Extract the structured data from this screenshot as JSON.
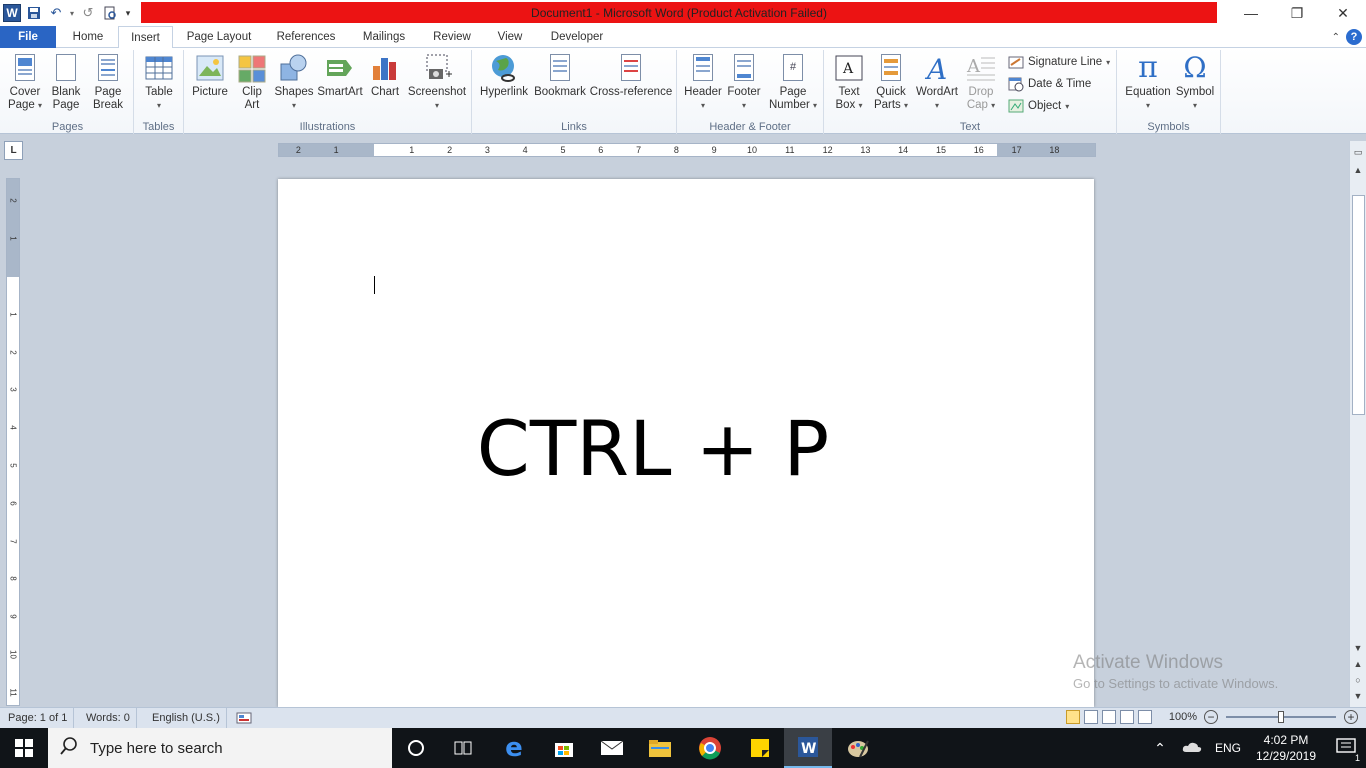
{
  "window": {
    "title": "Document1  -  Microsoft Word (Product Activation Failed)"
  },
  "tabs": [
    "File",
    "Home",
    "Insert",
    "Page Layout",
    "References",
    "Mailings",
    "Review",
    "View",
    "Developer"
  ],
  "active_tab": "Insert",
  "ribbon": {
    "pages": {
      "label": "Pages",
      "cover_page": [
        "Cover",
        "Page"
      ],
      "blank_page": [
        "Blank",
        "Page"
      ],
      "page_break": [
        "Page",
        "Break"
      ]
    },
    "tables": {
      "label": "Tables",
      "table": "Table"
    },
    "illustrations": {
      "label": "Illustrations",
      "picture": "Picture",
      "clip_art": [
        "Clip",
        "Art"
      ],
      "shapes": "Shapes",
      "smartart": "SmartArt",
      "chart": "Chart",
      "screenshot": "Screenshot"
    },
    "links": {
      "label": "Links",
      "hyperlink": "Hyperlink",
      "bookmark": "Bookmark",
      "cross_reference": "Cross-reference"
    },
    "header_footer": {
      "label": "Header & Footer",
      "header": "Header",
      "footer": "Footer",
      "page_number": [
        "Page",
        "Number"
      ]
    },
    "text": {
      "label": "Text",
      "text_box": [
        "Text",
        "Box"
      ],
      "quick_parts": [
        "Quick",
        "Parts"
      ],
      "wordart": "WordArt",
      "drop_cap": [
        "Drop",
        "Cap"
      ],
      "signature_line": "Signature Line",
      "date_time": "Date & Time",
      "object": "Object"
    },
    "symbols": {
      "label": "Symbols",
      "equation": "Equation",
      "symbol": "Symbol"
    }
  },
  "ruler_corner": "L",
  "document": {
    "text": "CTRL + P"
  },
  "watermark": {
    "line1": "Activate Windows",
    "line2": "Go to Settings to activate Windows."
  },
  "status": {
    "page": "Page: 1 of 1",
    "words": "Words: 0",
    "language": "English (U.S.)",
    "zoom": "100%"
  },
  "taskbar": {
    "search_placeholder": "Type here to search",
    "language": "ENG",
    "time": "4:02 PM",
    "date": "12/29/2019",
    "notification_count": "1"
  },
  "colors": {
    "title_bar_warning": "#ec1313",
    "file_tab": "#2a65c4",
    "taskbar": "#101418"
  }
}
